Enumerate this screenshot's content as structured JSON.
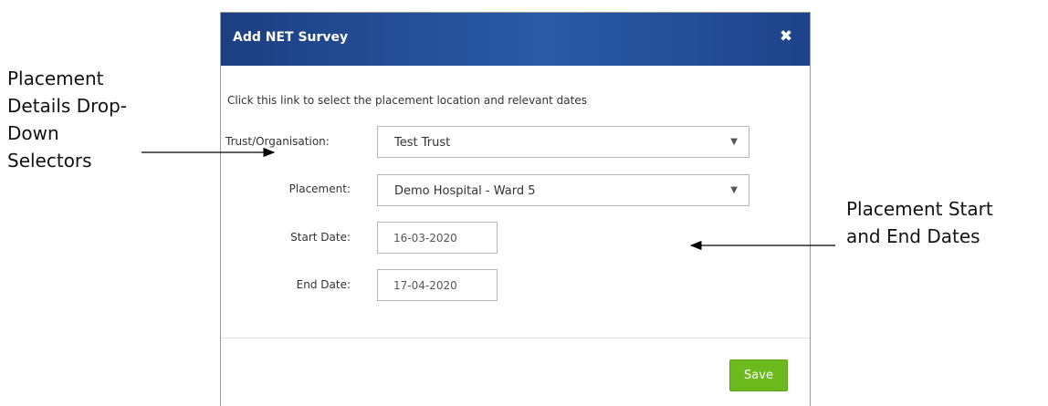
{
  "annotations": {
    "left_note_lines": [
      "Placement",
      "Details Drop-",
      "Down",
      "Selectors"
    ],
    "right_note_lines": [
      "Placement Start",
      "and End Dates"
    ]
  },
  "modal": {
    "title": "Add NET Survey",
    "close_icon": "close-icon",
    "close_glyph": "✖",
    "intro": "Click this link to select the placement location and relevant dates",
    "fields": {
      "trust_label": "Trust/Organisation:",
      "trust_value": "Test Trust",
      "placement_label": "Placement:",
      "placement_value": "Demo Hospital - Ward 5",
      "start_label": "Start Date:",
      "start_value": "16-03-2020",
      "end_label": "End Date:",
      "end_value": "17-04-2020",
      "caret_glyph": "▼"
    },
    "save_label": "Save"
  },
  "colors": {
    "header_blue": "#2a5aa6",
    "save_green": "#6cba1e"
  }
}
